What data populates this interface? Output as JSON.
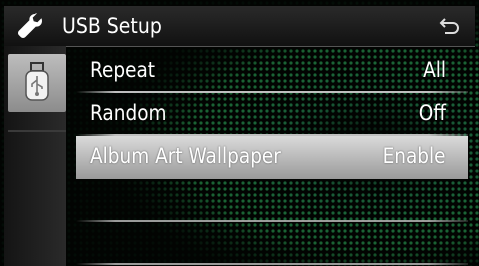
{
  "header": {
    "title": "USB Setup",
    "settings_icon": "wrench-icon",
    "back_icon": "back-arrow-icon"
  },
  "sidebar": {
    "tab_icon": "usb-icon"
  },
  "settings": [
    {
      "label": "Repeat",
      "value": "All",
      "selected": false
    },
    {
      "label": "Random",
      "value": "Off",
      "selected": false
    },
    {
      "label": "Album Art Wallpaper",
      "value": "Enable",
      "selected": true
    }
  ],
  "colors": {
    "accent_green": "#2f9a52",
    "selected_row": "#c8c8c8",
    "text": "#ffffff"
  }
}
